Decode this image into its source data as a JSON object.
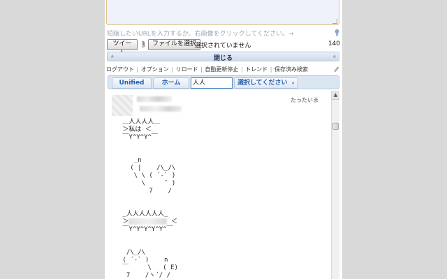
{
  "compose": {
    "hint": "短縮したいURLを入力するか、右画像をクリックしてください。→",
    "tweet_label": "ツイート",
    "file_button_label": "ファイルを選択",
    "file_status": "選択されていません",
    "remaining": "140"
  },
  "close_bar": {
    "label": "閉じる",
    "chevron": "«"
  },
  "nav": {
    "items": [
      "ログアウト",
      "オプション",
      "リロード",
      "自動更新停止",
      "トレンド",
      "保存済み検索"
    ],
    "separator": "|"
  },
  "tabs": {
    "unified": "Unified",
    "home": "ホーム",
    "search_value": "人人",
    "select_label": "選択してください",
    "select_arrow": "»"
  },
  "tweet": {
    "time": "たったいま",
    "body_line1": " ＿人人人人＿\n ＞私は ＜\n ￣Y^Y^Y^￣\n\n\n    _n\n   ( |    /\\_/\\\n    \\ \\ ( ´-` )\n      \\     ̄  )\n        7    /\n\n\n _人人人人人人_\n ＞",
    "body_line2": " ＜\n ￣Y^Y^Y^Y^Y^￣\n\n\n  /\\_/\\\n ( ´-` )    n\n ￣     \\   ( E)\n  7    /ヽ´/ /"
  },
  "scrollbar": {
    "up_arrow": "▲"
  }
}
